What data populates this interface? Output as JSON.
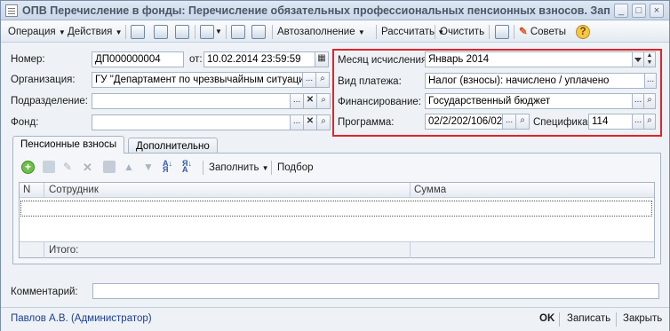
{
  "window": {
    "title": "ОПВ Перечисление в фонды: Перечисление обязательных профессиональных пенсионных взносов. Записан",
    "controls": {
      "minimize": "_",
      "maximize": "□",
      "close": "×"
    }
  },
  "toolbar": {
    "operation": "Операция",
    "actions": "Действия",
    "autofill": "Автозаполнение",
    "calculate": "Рассчитать",
    "clear": "Очистить",
    "tips": "Советы",
    "help": "?"
  },
  "form": {
    "number_label": "Номер:",
    "number_value": "ДП000000004",
    "date_label": "от:",
    "date_value": "10.02.2014 23:59:59",
    "org_label": "Организация:",
    "org_value": "ГУ \"Департамент по чрезвычайным ситуация",
    "subdivision_label": "Подразделение:",
    "subdivision_value": "",
    "fund_label": "Фонд:",
    "fund_value": "",
    "month_label": "Месяц исчисления:",
    "month_value": "Январь 2014",
    "payment_type_label": "Вид платежа:",
    "payment_type_value": "Налог (взносы): начислено / уплачено",
    "financing_label": "Финансирование:",
    "financing_value": "Государственный бюджет",
    "program_label": "Программа:",
    "program_value": "02/2/202/106/02",
    "specifics_label": "Специфика:",
    "specifics_value": "114",
    "comment_label": "Комментарий:",
    "comment_value": ""
  },
  "tabs": {
    "pension": "Пенсионные взносы",
    "additional": "Дополнительно"
  },
  "grid_toolbar": {
    "fill": "Заполнить",
    "select": "Подбор"
  },
  "grid": {
    "columns": [
      "N",
      "Сотрудник",
      "Сумма"
    ],
    "total_label": "Итого:"
  },
  "status": {
    "user": "Павлов А.В. (Администратор)",
    "ok": "OK",
    "save": "Записать",
    "close": "Закрыть"
  },
  "colors": {
    "highlight_border": "#e0242a",
    "link": "#1a3e8f"
  }
}
